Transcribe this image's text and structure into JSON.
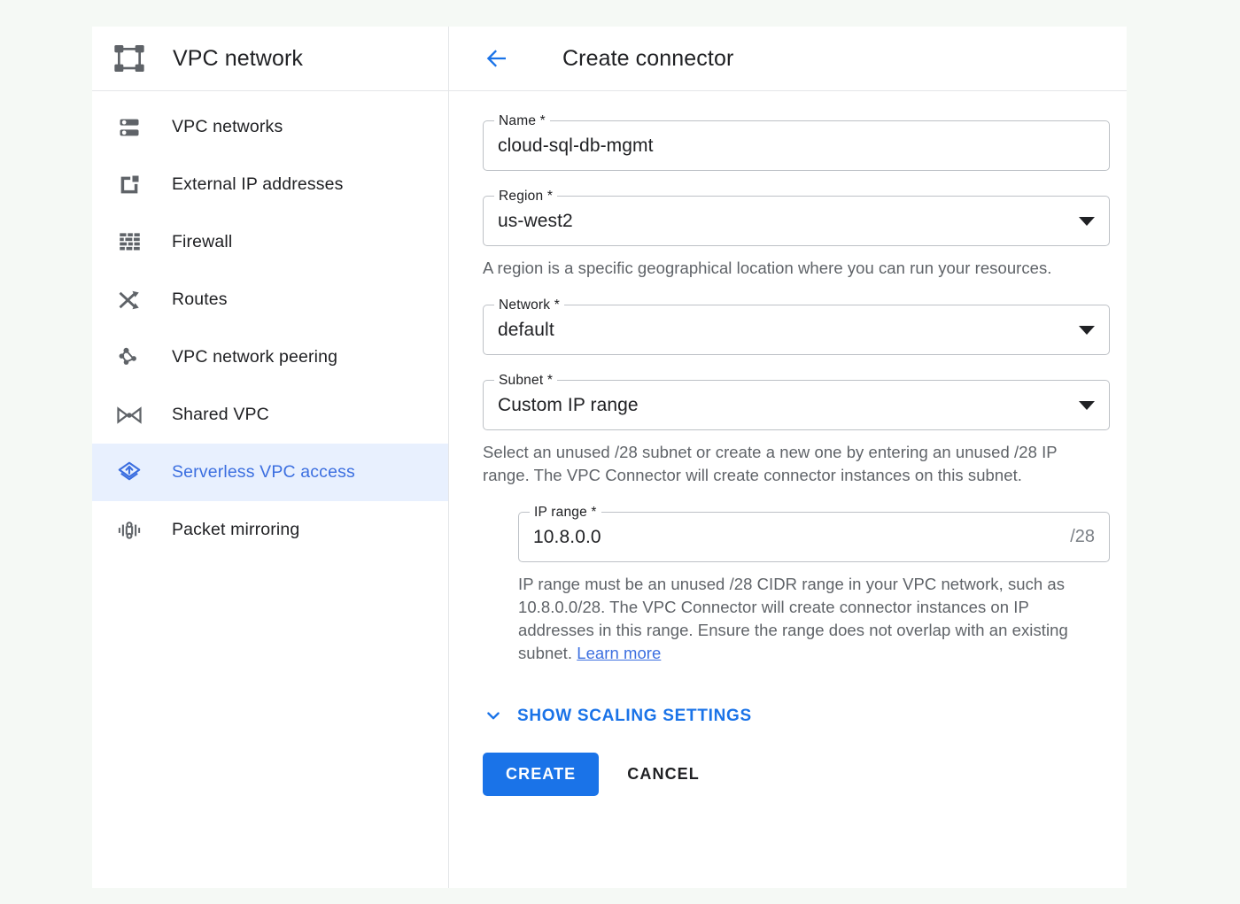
{
  "colors": {
    "page_background": "#f5f9f5",
    "card_background": "#ffffff",
    "accent_blue": "#1a73e8",
    "active_item_background": "#e8f0fe",
    "active_item_text": "#3c6fe0",
    "text_primary": "#202124",
    "text_secondary": "#5f6368",
    "border": "#bdc1c6"
  },
  "sidebar": {
    "brand_icon": "vpc-network-icon",
    "brand_title": "VPC network",
    "items": [
      {
        "label": "VPC networks",
        "icon": "vpc-networks-icon",
        "active": false
      },
      {
        "label": "External IP addresses",
        "icon": "external-ip-icon",
        "active": false
      },
      {
        "label": "Firewall",
        "icon": "firewall-brick-icon",
        "active": false
      },
      {
        "label": "Routes",
        "icon": "routes-shuffle-icon",
        "active": false
      },
      {
        "label": "VPC network peering",
        "icon": "network-peering-icon",
        "active": false
      },
      {
        "label": "Shared VPC",
        "icon": "shared-vpc-bowtie-icon",
        "active": false
      },
      {
        "label": "Serverless VPC access",
        "icon": "serverless-vpc-access-icon",
        "active": true
      },
      {
        "label": "Packet mirroring",
        "icon": "packet-mirroring-icon",
        "active": false
      }
    ]
  },
  "content": {
    "back_icon": "back-arrow-icon",
    "title": "Create connector"
  },
  "form": {
    "name": {
      "label": "Name *",
      "value": "cloud-sql-db-mgmt",
      "placeholder": "Name"
    },
    "region": {
      "label": "Region *",
      "value": "us-west2",
      "caret_icon": "chevron-down-icon",
      "helper": "A region is a specific geographical location where you can run your resources."
    },
    "network": {
      "label": "Network *",
      "value": "default",
      "caret_icon": "chevron-down-icon"
    },
    "subnet": {
      "label": "Subnet *",
      "value": "Custom IP range",
      "caret_icon": "chevron-down-icon",
      "helper": "Select an unused /28 subnet or create a new one by entering an unused /28 IP range. The VPC Connector will create connector instances on this subnet."
    },
    "ip_range": {
      "label": "IP range *",
      "value": "10.8.0.0",
      "suffix": "/28",
      "helper": "IP range must be an unused /28 CIDR range in your VPC network, such as 10.8.0.0/28. The VPC Connector will create connector instances on IP addresses in this range. Ensure the range does not overlap with an existing subnet. ",
      "link_label": "Learn more"
    }
  },
  "footer": {
    "scaling_toggle_icon": "chevron-down-icon",
    "scaling_toggle_label": "SHOW SCALING SETTINGS",
    "create_label": "CREATE",
    "cancel_label": "CANCEL"
  }
}
